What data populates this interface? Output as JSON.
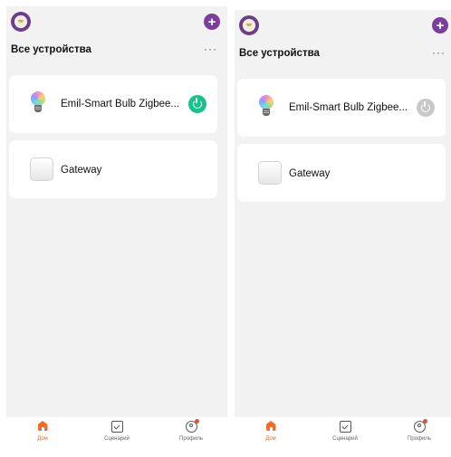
{
  "screens": [
    {
      "header": {
        "title": "Все устройства",
        "more": "···",
        "add": "+"
      },
      "devices": [
        {
          "name": "Emil-Smart Bulb Zigbee...",
          "power": "on"
        },
        {
          "name": "Gateway"
        }
      ],
      "tabs": {
        "home": "Дом",
        "scenes": "Сценарий",
        "profile": "Профиль"
      }
    },
    {
      "header": {
        "title": "Все устройства",
        "more": "···",
        "add": "+"
      },
      "devices": [
        {
          "name": "Emil-Smart Bulb Zigbee...",
          "power": "off"
        },
        {
          "name": "Gateway"
        }
      ],
      "tabs": {
        "home": "Дом",
        "scenes": "Сценарий",
        "profile": "Профиль"
      }
    }
  ],
  "colors": {
    "accent_purple": "#7b3f9a",
    "power_on": "#18c28a",
    "power_off": "#c8c8c8",
    "tab_active": "#f26a28",
    "notification_dot": "#f04a3a"
  }
}
